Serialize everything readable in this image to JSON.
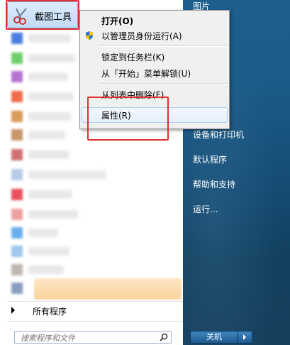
{
  "pinned": {
    "label": "截图工具"
  },
  "context_menu": {
    "open": "打开(O)",
    "run_as_admin": "以管理员身份运行(A)",
    "pin_taskbar": "锁定到任务栏(K)",
    "unpin_start": "从「开始」菜单解锁(U)",
    "remove_list": "从列表中删除(F)",
    "properties": "属性(R)"
  },
  "right_pane": {
    "pictures": "图片",
    "devices": "设备和打印机",
    "default_programs": "默认程序",
    "help": "帮助和支持",
    "run": "运行..."
  },
  "all_programs": "所有程序",
  "search": {
    "placeholder": "搜索程序和文件"
  },
  "shutdown": {
    "label": "关机"
  },
  "colors": {
    "highlight_red": "#e0302e",
    "start_blue": "#1d5f8e"
  }
}
